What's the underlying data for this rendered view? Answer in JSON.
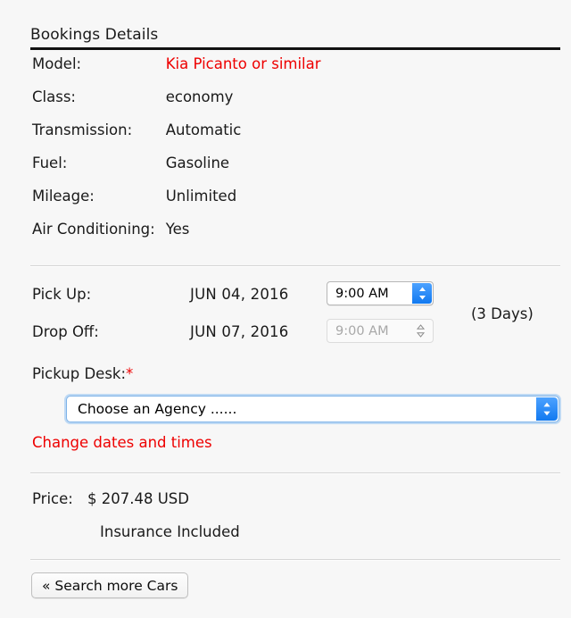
{
  "panel": {
    "title": "Bookings Details"
  },
  "specs": {
    "rows": [
      {
        "label": "Model:",
        "value": "Kia Picanto or similar",
        "accent": true
      },
      {
        "label": "Class:",
        "value": "economy",
        "accent": false
      },
      {
        "label": "Transmission:",
        "value": "Automatic",
        "accent": false
      },
      {
        "label": "Fuel:",
        "value": "Gasoline",
        "accent": false
      },
      {
        "label": "Mileage:",
        "value": "Unlimited",
        "accent": false
      },
      {
        "label": "Air Conditioning:",
        "value": "Yes",
        "accent": false
      }
    ]
  },
  "schedule": {
    "pickup": {
      "label": "Pick Up:",
      "date": "JUN 04, 2016",
      "time": "9:00 AM"
    },
    "dropoff": {
      "label": "Drop Off:",
      "date": "JUN 07, 2016",
      "time": "9:00 AM"
    },
    "duration": "(3 Days)"
  },
  "pickup_desk": {
    "label": "Pickup Desk:",
    "required_marker": "*",
    "selected": "Choose an Agency ......"
  },
  "change_link": {
    "label": "Change dates and times"
  },
  "price": {
    "label": "Price:",
    "amount": "$ 207.48 USD",
    "note": "Insurance Included"
  },
  "footer": {
    "search_button": "« Search more Cars"
  },
  "colors": {
    "accent_red": "#ee0000",
    "focus_blue": "#7fb3e8",
    "stepper_blue": "#1179f0",
    "background": "#f7f7f7",
    "text": "#1a1a1a",
    "divider": "#d6d6d6",
    "title_rule": "#121212"
  }
}
